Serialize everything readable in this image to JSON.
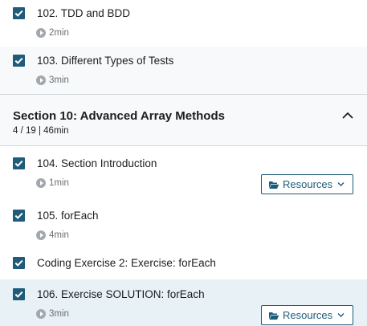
{
  "items_top": [
    {
      "title": "102. TDD and BDD",
      "duration": "2min",
      "completed": true
    },
    {
      "title": "103. Different Types of Tests",
      "duration": "3min",
      "completed": true
    }
  ],
  "section": {
    "title": "Section 10: Advanced Array Methods",
    "progress": "4 / 19 | 46min",
    "expanded": true
  },
  "items": [
    {
      "title": "104. Section Introduction",
      "duration": "1min",
      "completed": true,
      "resources_label": "Resources"
    },
    {
      "title": "105. forEach",
      "duration": "4min",
      "completed": true
    },
    {
      "title": "Coding Exercise 2: Exercise: forEach",
      "completed": true
    },
    {
      "title": "106. Exercise SOLUTION: forEach",
      "duration": "3min",
      "completed": true,
      "resources_label": "Resources",
      "active": true
    }
  ],
  "colors": {
    "checkbox": "#1f5c7a",
    "active_row": "#e7f1f6",
    "section_bg": "#f7f9fa",
    "muted_text": "#6a6f73"
  },
  "icons": {
    "checkbox": "checkmark-icon",
    "play": "play-circle-icon",
    "folder": "folder-open-icon",
    "chevron_down": "chevron-down-icon",
    "chevron_up": "chevron-up-icon"
  }
}
